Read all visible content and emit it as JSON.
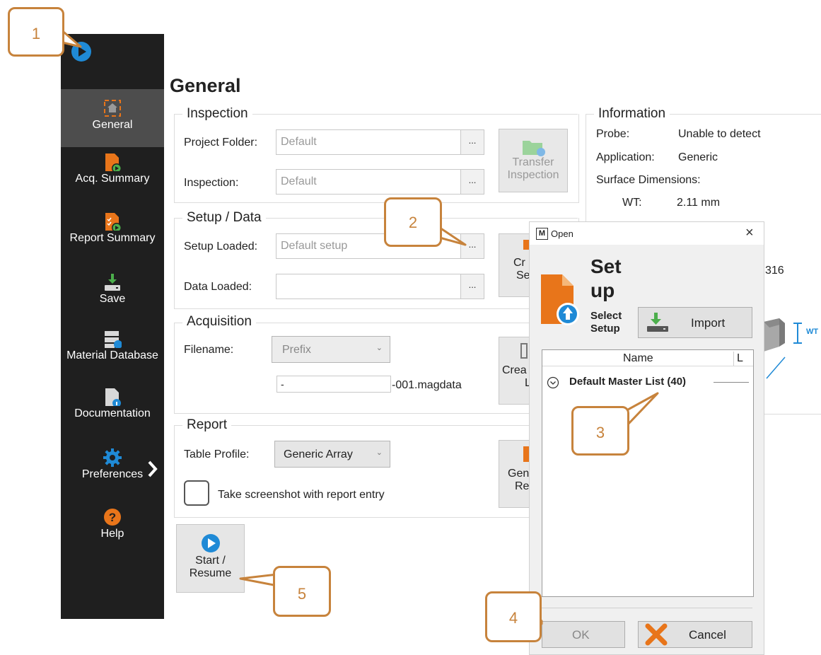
{
  "sidebar": {
    "items": [
      {
        "label": "General"
      },
      {
        "label": "Acq. Summary"
      },
      {
        "label": "Report Summary"
      },
      {
        "label": "Save"
      },
      {
        "label": "Material Database"
      },
      {
        "label": "Documentation"
      },
      {
        "label": "Preferences"
      },
      {
        "label": "Help"
      }
    ]
  },
  "page": {
    "title": "General"
  },
  "inspection": {
    "title": "Inspection",
    "project_folder_label": "Project Folder:",
    "project_folder_value": "Default",
    "inspection_label": "Inspection:",
    "inspection_value": "Default",
    "dots": "...",
    "transfer_label_1": "Transfer",
    "transfer_label_2": "Inspection"
  },
  "setup": {
    "title": "Setup / Data",
    "setup_loaded_label": "Setup Loaded:",
    "setup_loaded_value": "Default setup",
    "data_loaded_label": "Data Loaded:",
    "data_loaded_value": "",
    "create_btn_1": "Cr",
    "create_btn_2": "Se"
  },
  "acquisition": {
    "title": "Acquisition",
    "filename_label": "Filename:",
    "prefix_value": "Prefix",
    "name_value": "-",
    "suffix": "-001.magdata",
    "create_btn_1": "Crea",
    "create_btn_2": "L"
  },
  "report": {
    "title": "Report",
    "table_profile_label": "Table Profile:",
    "table_profile_value": "Generic Array",
    "screenshot_label": "Take screenshot with report entry",
    "gen_btn_1": "Gen",
    "gen_btn_2": "Re"
  },
  "start": {
    "label_1": "Start /",
    "label_2": "Resume"
  },
  "information": {
    "title": "Information",
    "probe_label": "Probe:",
    "probe_value": "Unable to detect",
    "application_label": "Application:",
    "application_value": "Generic",
    "surface_label": "Surface Dimensions:",
    "wt_label": "WT:",
    "wt_value": "2.11 mm",
    "partial_316": "316",
    "wt_tag": "WT"
  },
  "dialog": {
    "app_letter": "M",
    "title": "Open",
    "close": "×",
    "heading_1": "Set",
    "heading_2": "up",
    "sub_1": "Select",
    "sub_2": "Setup",
    "import_label": "Import",
    "col_name": "Name",
    "col_l": "L",
    "list_item": "Default Master List (40)",
    "ok_label": "OK",
    "cancel_label": "Cancel"
  },
  "callouts": [
    "1",
    "2",
    "3",
    "4",
    "5"
  ],
  "colors": {
    "accent": "#e8751a",
    "callout": "#c7833c",
    "play_blue": "#1f8ad6",
    "sidebar_bg": "#1f1f1f"
  }
}
